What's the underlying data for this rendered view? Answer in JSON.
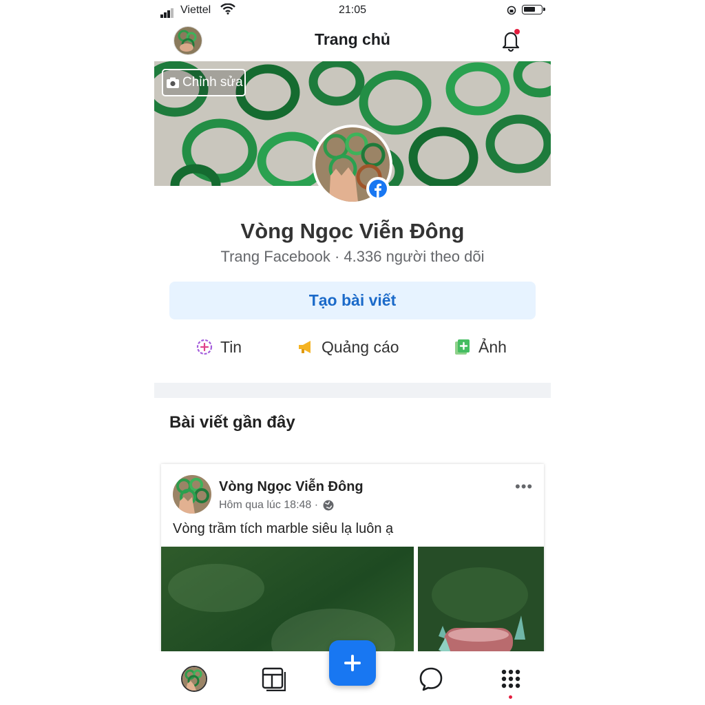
{
  "status_bar": {
    "carrier": "Viettel",
    "time": "21:05"
  },
  "header": {
    "title": "Trang chủ"
  },
  "cover": {
    "edit_label": "Chỉnh sửa"
  },
  "page": {
    "name": "Vòng Ngọc Viễn Đông",
    "subtitle": "Trang Facebook · 4.336 người theo dõi"
  },
  "create_post_label": "Tạo bài viết",
  "actions": [
    {
      "label": "Tin",
      "icon": "story-plus-icon"
    },
    {
      "label": "Quảng cáo",
      "icon": "megaphone-icon"
    },
    {
      "label": "Ảnh",
      "icon": "photo-add-icon"
    }
  ],
  "recent_posts_title": "Bài viết gần đây",
  "post": {
    "author": "Vòng Ngọc Viễn Đông",
    "time": "Hôm qua lúc 18:48 ·",
    "text": "Vòng trầm tích marble siêu lạ luôn ạ",
    "more": "•••"
  },
  "colors": {
    "accent": "#1877f2",
    "create_bg": "#e7f3ff",
    "create_text": "#1b6ac9",
    "notification_dot": "#e41e3f"
  },
  "tabbar": [
    "profile-avatar",
    "pages-icon",
    "create-plus-icon",
    "messenger-icon",
    "menu-grid-icon"
  ]
}
